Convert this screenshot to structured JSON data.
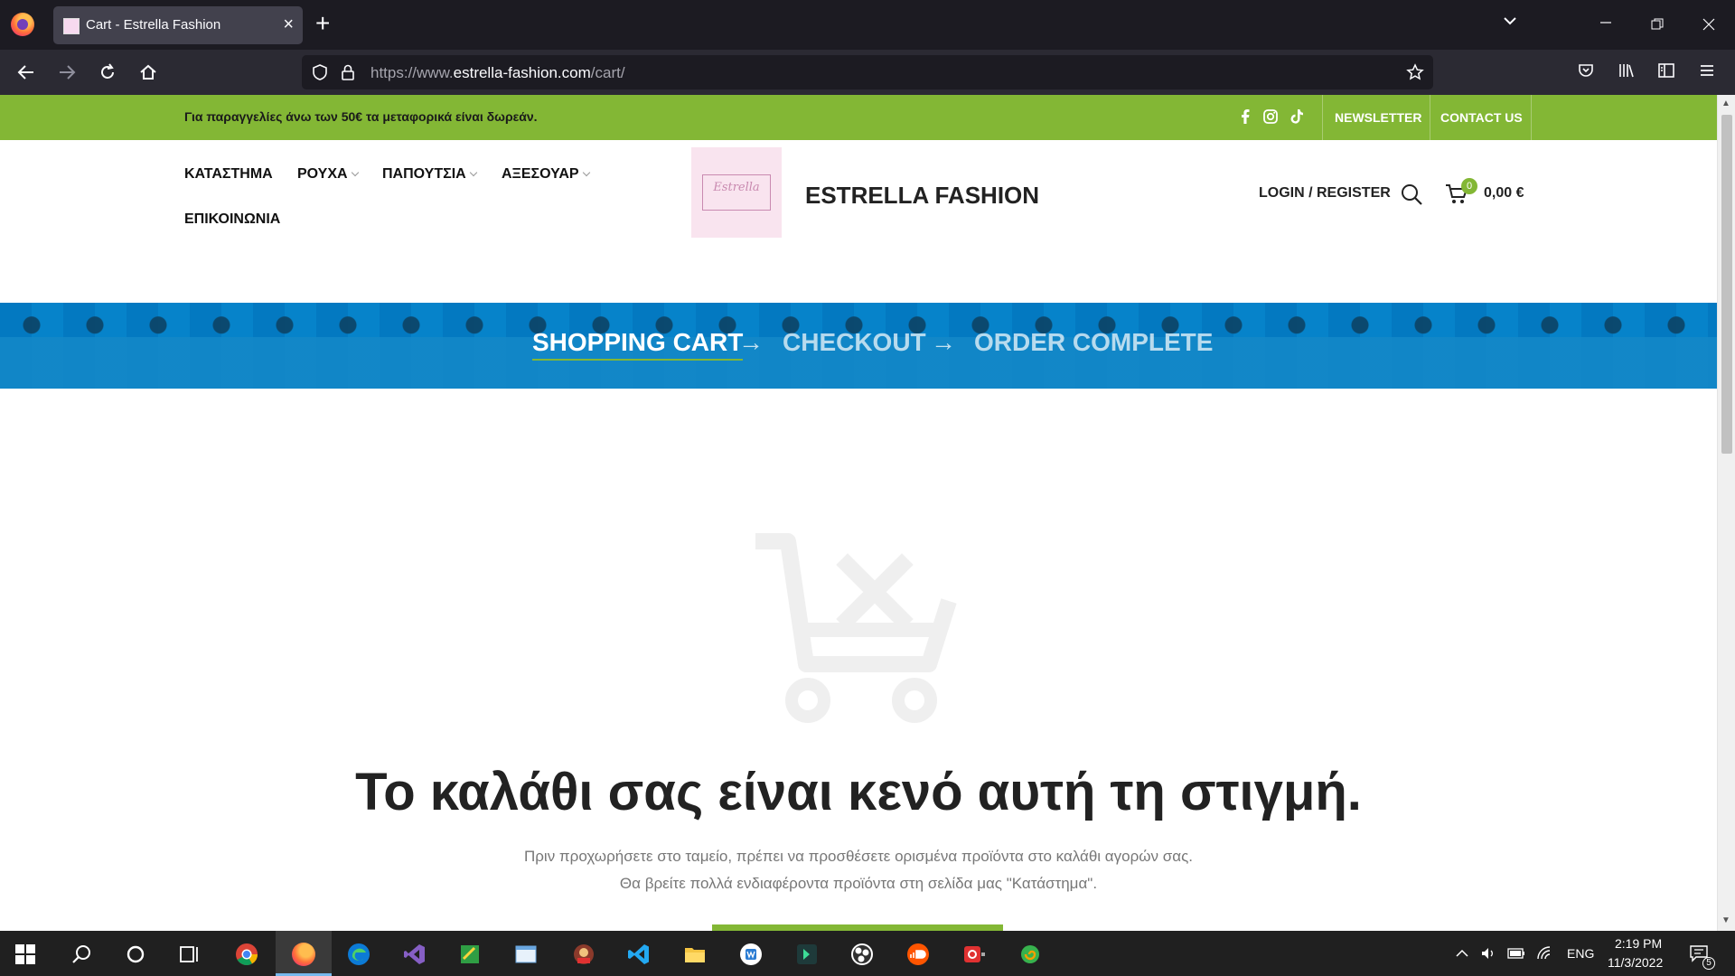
{
  "browser": {
    "tab_title": "Cart - Estrella Fashion",
    "url_prefix": "https://www.",
    "url_domain": "estrella-fashion.com",
    "url_path": "/cart/"
  },
  "topbar": {
    "promo": "Για παραγγελίες άνω των 50€ τα μεταφορικά είναι δωρεάν.",
    "newsletter": "NEWSLETTER",
    "contact": "CONTACT US"
  },
  "header": {
    "menu": {
      "store": "ΚΑΤΑΣΤΗΜΑ",
      "clothes": "ΡΟΥΧΑ",
      "shoes": "ΠΑΠΟΥΤΣΙΑ",
      "accessories": "ΑΞΕΣΟΥΑΡ",
      "contact": "ΕΠΙΚΟΙΝΩΝΙΑ"
    },
    "logo_text": "Estrella",
    "site_title": "ESTRELLA FASHION",
    "login": "LOGIN / REGISTER",
    "cart_count": "0",
    "cart_total": "0,00 €"
  },
  "steps": {
    "cart": "SHOPPING CART",
    "checkout": "CHECKOUT",
    "complete": "ORDER COMPLETE",
    "arrow": "→"
  },
  "empty": {
    "title": "Το καλάθι σας είναι κενό αυτή τη στιγμή.",
    "line1": "Πριν προχωρήσετε στο ταμείο, πρέπει να προσθέσετε ορισμένα προϊόντα στο καλάθι αγορών σας.",
    "line2": "Θα βρείτε πολλά ενδιαφέροντα προϊόντα στη σελίδα μας \"Κατάστημα\"."
  },
  "tray": {
    "lang": "ENG",
    "time": "2:19 PM",
    "date": "11/3/2022",
    "notif_count": "5"
  },
  "colors": {
    "brand_green": "#83b735",
    "banner_blue": "#0688cf"
  }
}
